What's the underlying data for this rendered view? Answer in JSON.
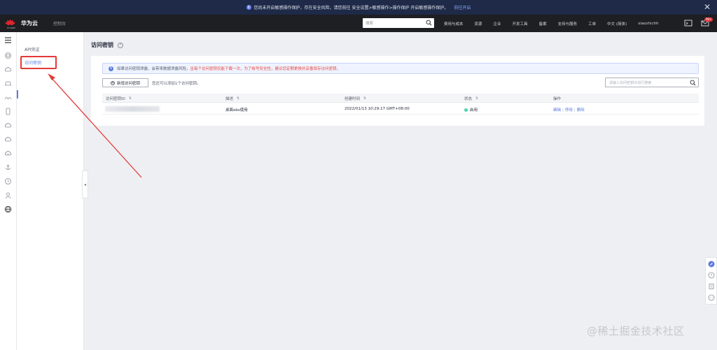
{
  "banner": {
    "message": "您尚未开启敏感操作保护，存在安全风险，请您前往 安全设置>敏感操作>操作保护 开启敏感操作保护。",
    "link": "前往开启",
    "close": "✕"
  },
  "topbar": {
    "logo_text": "HUAWEI",
    "brand": "华为云",
    "console": "控制台",
    "search_placeholder": "搜索",
    "nav": [
      "费用与成本",
      "资源",
      "企业",
      "开发工具",
      "备案",
      "支持与服务",
      "工单",
      "中文 (简体)",
      "xiaozhichh"
    ],
    "badge": "99+"
  },
  "sidebar": {
    "items": [
      {
        "label": "API凭证"
      },
      {
        "label": "访问密钥"
      }
    ],
    "collapse_glyph": "◂"
  },
  "page": {
    "title": "访问密钥",
    "help_glyph": "?"
  },
  "alert": {
    "icon": "i",
    "text_normal": "如果访问密钥泄露，会带来数据泄露风险，",
    "text_warn": "且每个访问密钥仅能下载一次，为了帐号安全性，建议您定期更换并妥善保存访问密钥。"
  },
  "toolbar": {
    "add_button": "新增访问密钥",
    "hint": "您还可以添加1个访问密钥。",
    "search_placeholder": "请输入访问密钥ID进行搜索"
  },
  "table": {
    "headers": [
      "访问密钥ID",
      "描述",
      "创建时间",
      "状态",
      "操作"
    ],
    "rows": [
      {
        "description": "桌面obs使用",
        "created": "2022/01/13 10:29:17 GMT+08:00",
        "status": "启用",
        "ops": [
          "编辑",
          "停用",
          "删除"
        ]
      }
    ]
  },
  "colors": {
    "accent": "#5e7ce0",
    "topbar": "#1e1f22",
    "banner": "#1e2a47",
    "annotation": "#e53935",
    "status_ok": "#50d4ab"
  },
  "watermark": "@稀土掘金技术社区"
}
